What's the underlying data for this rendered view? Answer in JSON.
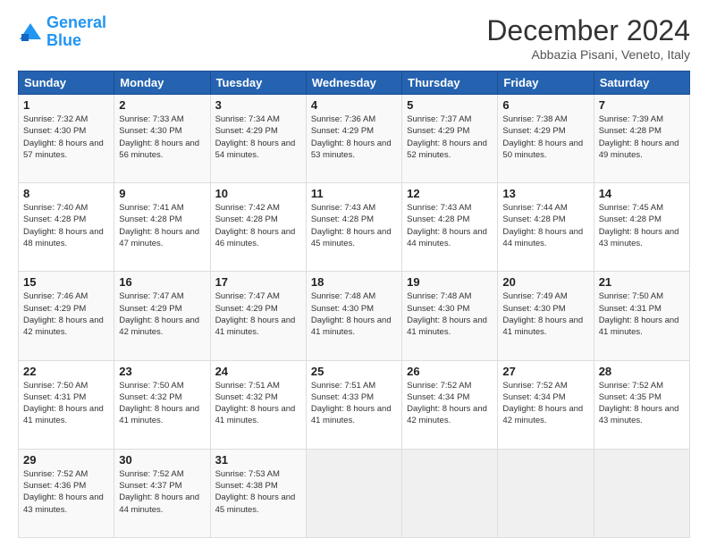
{
  "logo": {
    "line1": "General",
    "line2": "Blue"
  },
  "title": "December 2024",
  "location": "Abbazia Pisani, Veneto, Italy",
  "days_of_week": [
    "Sunday",
    "Monday",
    "Tuesday",
    "Wednesday",
    "Thursday",
    "Friday",
    "Saturday"
  ],
  "weeks": [
    [
      {
        "day": "1",
        "sunrise": "7:32 AM",
        "sunset": "4:30 PM",
        "daylight": "8 hours and 57 minutes."
      },
      {
        "day": "2",
        "sunrise": "7:33 AM",
        "sunset": "4:30 PM",
        "daylight": "8 hours and 56 minutes."
      },
      {
        "day": "3",
        "sunrise": "7:34 AM",
        "sunset": "4:29 PM",
        "daylight": "8 hours and 54 minutes."
      },
      {
        "day": "4",
        "sunrise": "7:36 AM",
        "sunset": "4:29 PM",
        "daylight": "8 hours and 53 minutes."
      },
      {
        "day": "5",
        "sunrise": "7:37 AM",
        "sunset": "4:29 PM",
        "daylight": "8 hours and 52 minutes."
      },
      {
        "day": "6",
        "sunrise": "7:38 AM",
        "sunset": "4:29 PM",
        "daylight": "8 hours and 50 minutes."
      },
      {
        "day": "7",
        "sunrise": "7:39 AM",
        "sunset": "4:28 PM",
        "daylight": "8 hours and 49 minutes."
      }
    ],
    [
      {
        "day": "8",
        "sunrise": "7:40 AM",
        "sunset": "4:28 PM",
        "daylight": "8 hours and 48 minutes."
      },
      {
        "day": "9",
        "sunrise": "7:41 AM",
        "sunset": "4:28 PM",
        "daylight": "8 hours and 47 minutes."
      },
      {
        "day": "10",
        "sunrise": "7:42 AM",
        "sunset": "4:28 PM",
        "daylight": "8 hours and 46 minutes."
      },
      {
        "day": "11",
        "sunrise": "7:43 AM",
        "sunset": "4:28 PM",
        "daylight": "8 hours and 45 minutes."
      },
      {
        "day": "12",
        "sunrise": "7:43 AM",
        "sunset": "4:28 PM",
        "daylight": "8 hours and 44 minutes."
      },
      {
        "day": "13",
        "sunrise": "7:44 AM",
        "sunset": "4:28 PM",
        "daylight": "8 hours and 44 minutes."
      },
      {
        "day": "14",
        "sunrise": "7:45 AM",
        "sunset": "4:28 PM",
        "daylight": "8 hours and 43 minutes."
      }
    ],
    [
      {
        "day": "15",
        "sunrise": "7:46 AM",
        "sunset": "4:29 PM",
        "daylight": "8 hours and 42 minutes."
      },
      {
        "day": "16",
        "sunrise": "7:47 AM",
        "sunset": "4:29 PM",
        "daylight": "8 hours and 42 minutes."
      },
      {
        "day": "17",
        "sunrise": "7:47 AM",
        "sunset": "4:29 PM",
        "daylight": "8 hours and 41 minutes."
      },
      {
        "day": "18",
        "sunrise": "7:48 AM",
        "sunset": "4:30 PM",
        "daylight": "8 hours and 41 minutes."
      },
      {
        "day": "19",
        "sunrise": "7:48 AM",
        "sunset": "4:30 PM",
        "daylight": "8 hours and 41 minutes."
      },
      {
        "day": "20",
        "sunrise": "7:49 AM",
        "sunset": "4:30 PM",
        "daylight": "8 hours and 41 minutes."
      },
      {
        "day": "21",
        "sunrise": "7:50 AM",
        "sunset": "4:31 PM",
        "daylight": "8 hours and 41 minutes."
      }
    ],
    [
      {
        "day": "22",
        "sunrise": "7:50 AM",
        "sunset": "4:31 PM",
        "daylight": "8 hours and 41 minutes."
      },
      {
        "day": "23",
        "sunrise": "7:50 AM",
        "sunset": "4:32 PM",
        "daylight": "8 hours and 41 minutes."
      },
      {
        "day": "24",
        "sunrise": "7:51 AM",
        "sunset": "4:32 PM",
        "daylight": "8 hours and 41 minutes."
      },
      {
        "day": "25",
        "sunrise": "7:51 AM",
        "sunset": "4:33 PM",
        "daylight": "8 hours and 41 minutes."
      },
      {
        "day": "26",
        "sunrise": "7:52 AM",
        "sunset": "4:34 PM",
        "daylight": "8 hours and 42 minutes."
      },
      {
        "day": "27",
        "sunrise": "7:52 AM",
        "sunset": "4:34 PM",
        "daylight": "8 hours and 42 minutes."
      },
      {
        "day": "28",
        "sunrise": "7:52 AM",
        "sunset": "4:35 PM",
        "daylight": "8 hours and 43 minutes."
      }
    ],
    [
      {
        "day": "29",
        "sunrise": "7:52 AM",
        "sunset": "4:36 PM",
        "daylight": "8 hours and 43 minutes."
      },
      {
        "day": "30",
        "sunrise": "7:52 AM",
        "sunset": "4:37 PM",
        "daylight": "8 hours and 44 minutes."
      },
      {
        "day": "31",
        "sunrise": "7:53 AM",
        "sunset": "4:38 PM",
        "daylight": "8 hours and 45 minutes."
      },
      null,
      null,
      null,
      null
    ]
  ]
}
